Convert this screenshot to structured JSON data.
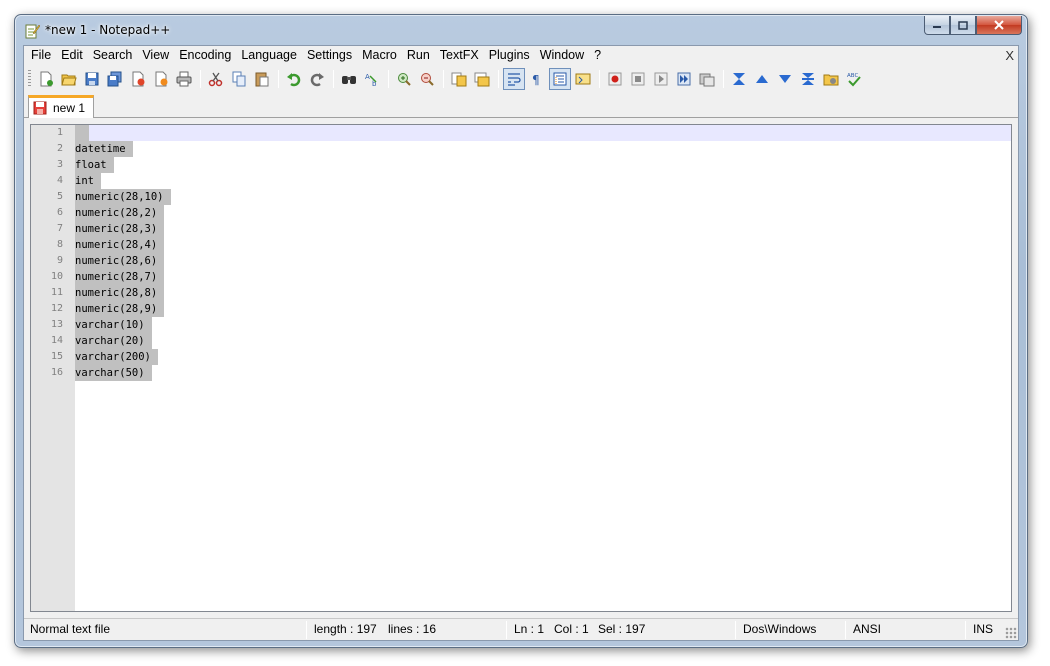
{
  "window": {
    "title": "*new  1 - Notepad++"
  },
  "menu": {
    "items": [
      "File",
      "Edit",
      "Search",
      "View",
      "Encoding",
      "Language",
      "Settings",
      "Macro",
      "Run",
      "TextFX",
      "Plugins",
      "Window",
      "?"
    ],
    "close_label": "X"
  },
  "toolbar": {
    "icons": [
      "new-file-icon",
      "open-file-icon",
      "save-icon",
      "save-all-icon",
      "close-icon",
      "close-all-icon",
      "print-icon",
      "cut-icon",
      "copy-icon",
      "paste-icon",
      "undo-icon",
      "redo-icon",
      "find-icon",
      "replace-icon",
      "zoom-in-icon",
      "zoom-out-icon",
      "sync-vertical-icon",
      "sync-horizontal-icon",
      "word-wrap-icon",
      "show-all-chars-icon",
      "indent-guide-icon",
      "user-lang-icon",
      "record-macro-icon",
      "stop-macro-icon",
      "play-macro-icon",
      "run-macro-multiple-icon",
      "save-macro-icon",
      "collapse-icon",
      "up-icon",
      "down-icon",
      "expand-icon",
      "folder-icon",
      "spell-check-icon"
    ]
  },
  "tabs": [
    {
      "label": "new  1"
    }
  ],
  "editor": {
    "current_line": 1,
    "lines": [
      {
        "num": "1",
        "text": ""
      },
      {
        "num": "2",
        "text": "datetime"
      },
      {
        "num": "3",
        "text": "float"
      },
      {
        "num": "4",
        "text": "int"
      },
      {
        "num": "5",
        "text": "numeric(28,10)"
      },
      {
        "num": "6",
        "text": "numeric(28,2)"
      },
      {
        "num": "7",
        "text": "numeric(28,3)"
      },
      {
        "num": "8",
        "text": "numeric(28,4)"
      },
      {
        "num": "9",
        "text": "numeric(28,6)"
      },
      {
        "num": "10",
        "text": "numeric(28,7)"
      },
      {
        "num": "11",
        "text": "numeric(28,8)"
      },
      {
        "num": "12",
        "text": "numeric(28,9)"
      },
      {
        "num": "13",
        "text": "varchar(10)"
      },
      {
        "num": "14",
        "text": "varchar(20)"
      },
      {
        "num": "15",
        "text": "varchar(200)"
      },
      {
        "num": "16",
        "text": "varchar(50)"
      }
    ]
  },
  "status": {
    "file_type": "Normal text file",
    "length": "length : 197",
    "lines": "lines : 16",
    "ln": "Ln : 1",
    "col": "Col : 1",
    "sel": "Sel : 197",
    "eol": "Dos\\Windows",
    "encoding": "ANSI",
    "mode": "INS"
  },
  "colors": {
    "selection": "#c0c0c0",
    "current_line": "#e8e8ff",
    "tab_accent": "#f6a827",
    "gutter": "#e4e4e4"
  }
}
